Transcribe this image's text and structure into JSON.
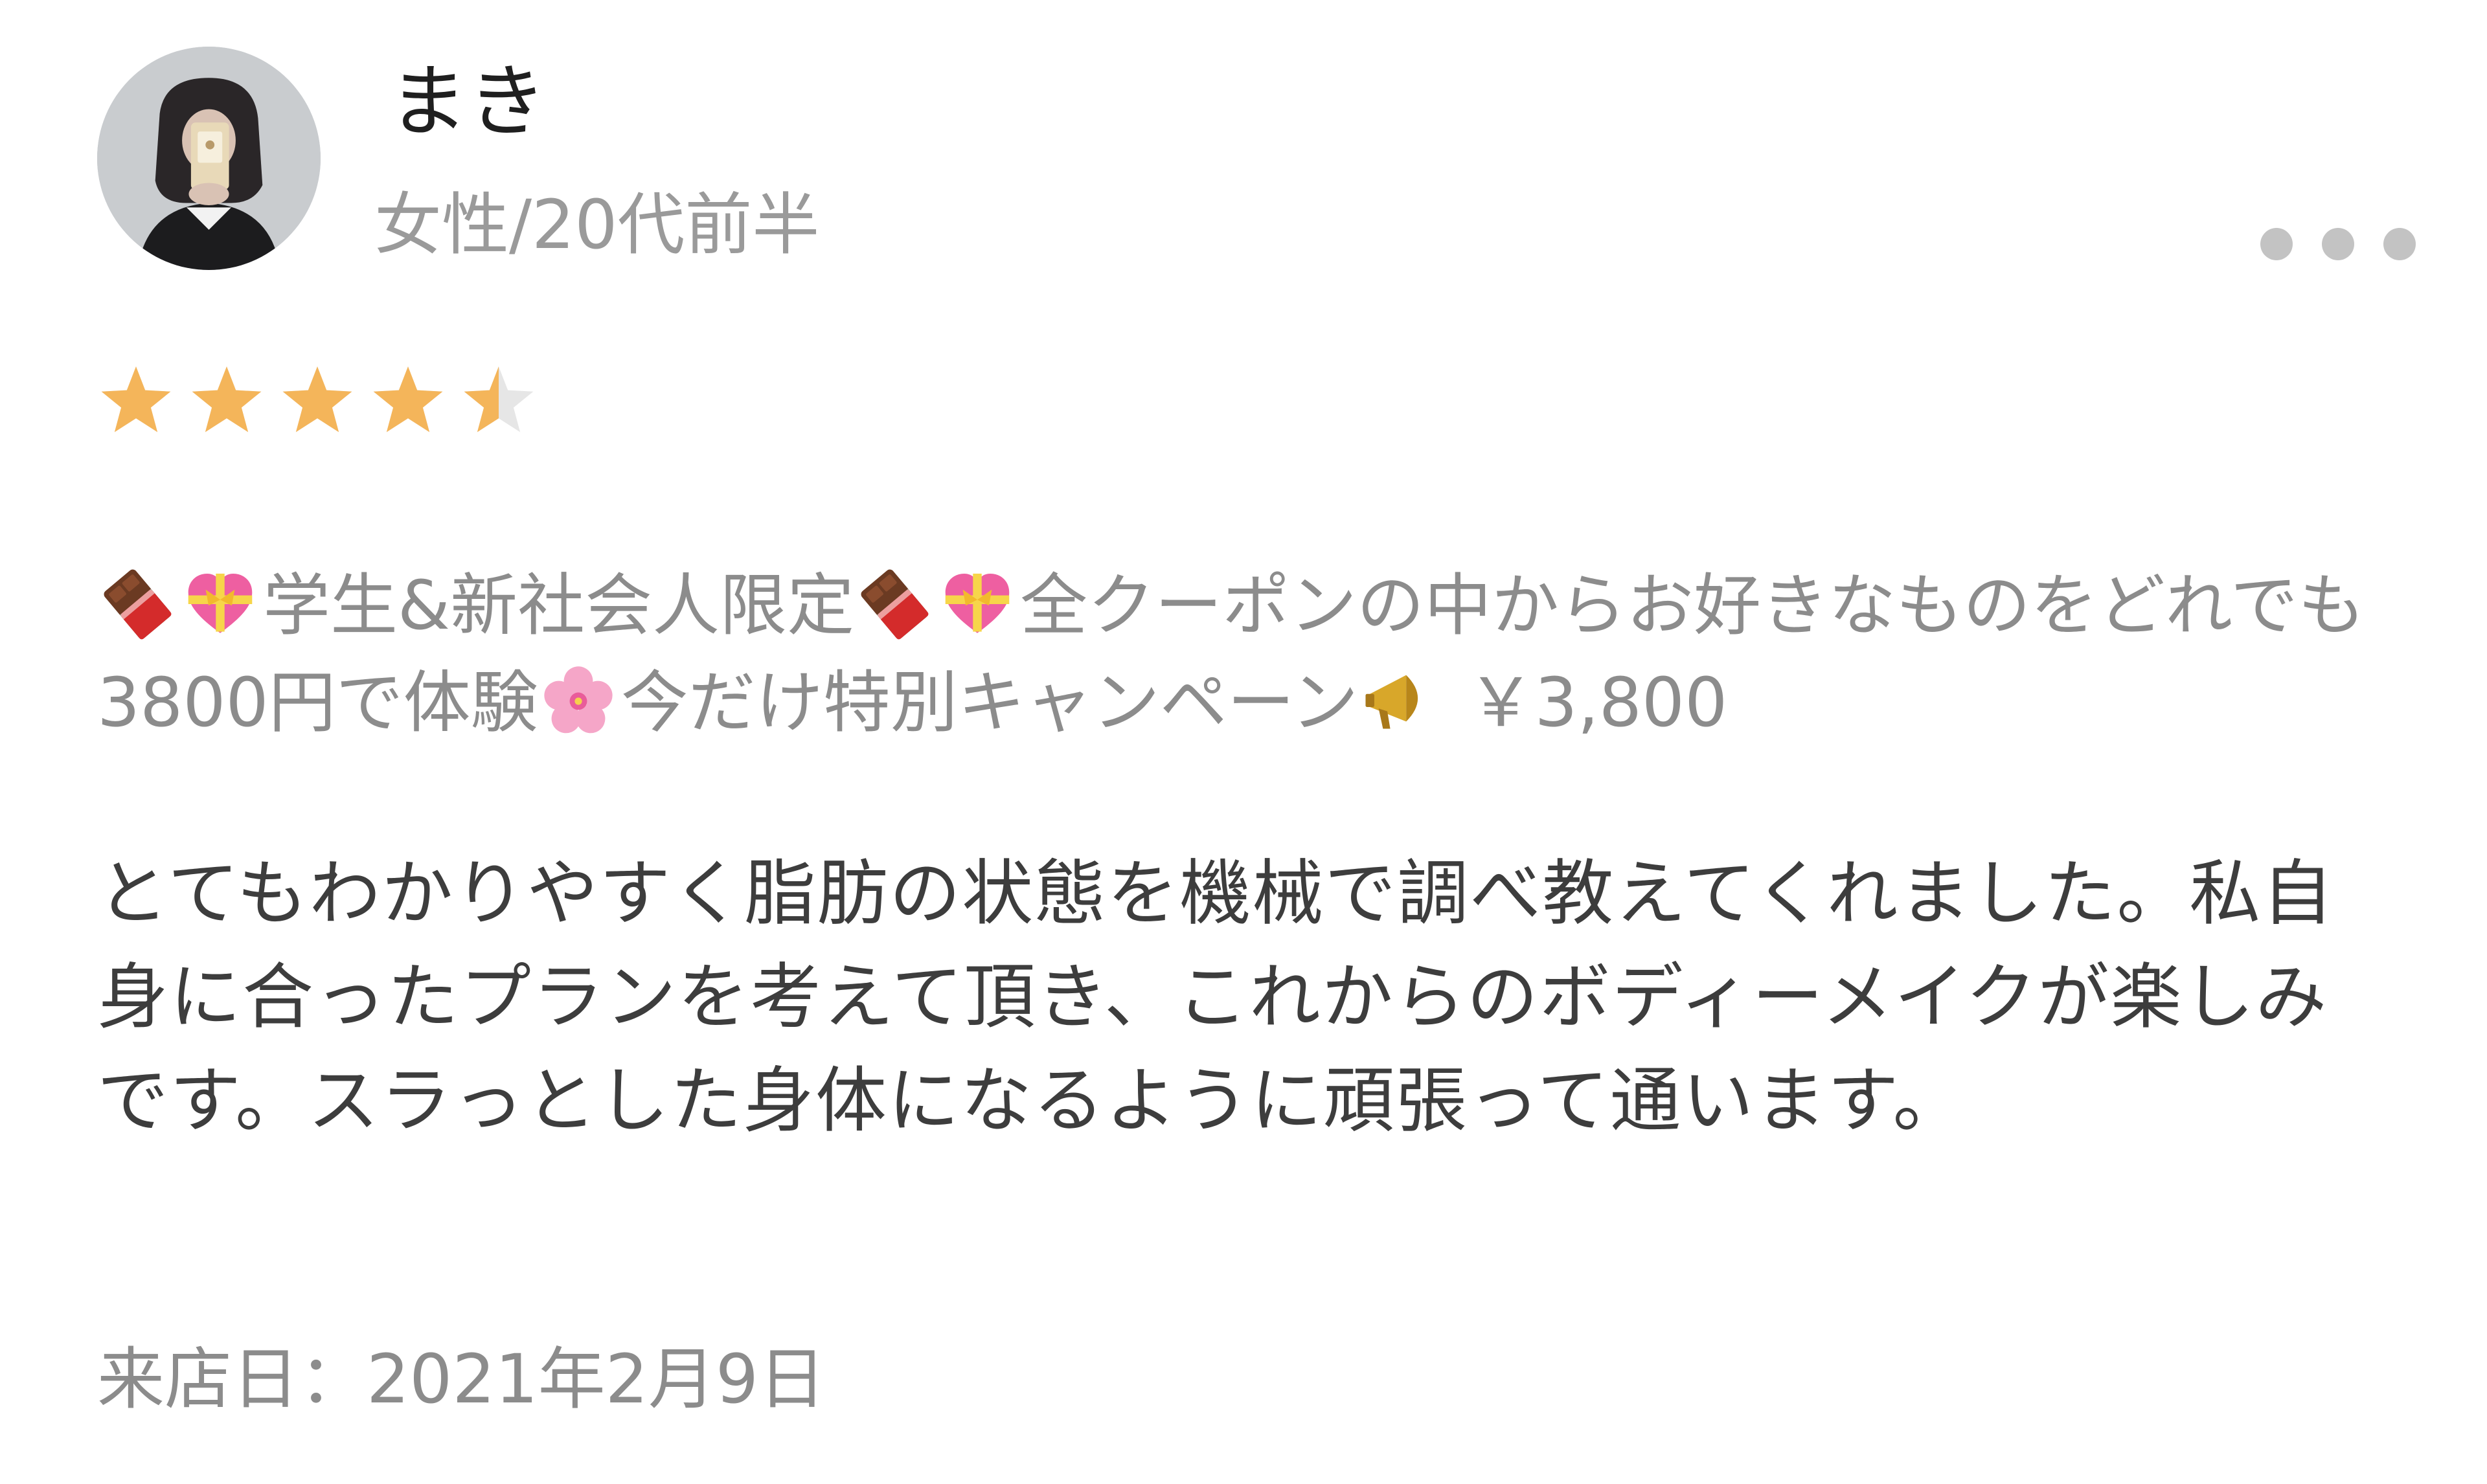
{
  "reviewer": {
    "name": "まき",
    "meta": "女性/20代前半"
  },
  "rating": {
    "value": 4.5,
    "max": 5,
    "color": "#f4b55a",
    "empty_color": "#e6e6e6"
  },
  "coupon": {
    "part1": "学生&新社会人限定",
    "part2": "全クーポンの中からお好きなものをどれでも3800円で体験",
    "part3": "今だけ特別キャンペーン",
    "price": "￥3,800",
    "icons": [
      "chocolate-bar-icon",
      "heart-with-ribbon-icon",
      "cherry-blossom-icon",
      "megaphone-icon"
    ]
  },
  "review": {
    "text": "とてもわかりやすく脂肪の状態を機械で調べ教えてくれました。私自身に合ったプランを考えて頂き、これからのボディーメイクが楽しみです。スラっとした身体になるように頑張って通います。"
  },
  "visit": {
    "text": "来店日：2021年2月9日"
  }
}
